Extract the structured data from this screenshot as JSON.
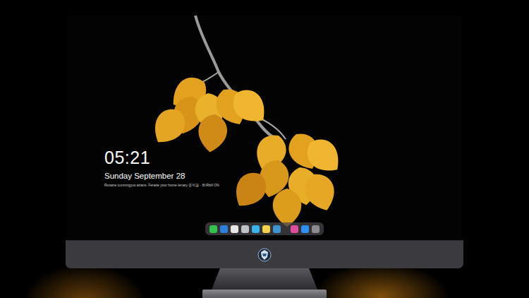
{
  "lock_screen": {
    "clock": "05:21",
    "date": "Sunday September  28",
    "notice": "Rosane cunnnrgyus arians. Feraite your home lenary 웅력결 · 8i:Rbill ON"
  },
  "dock": {
    "items": [
      {
        "color": "#34c24c"
      },
      {
        "color": "#2f7fe0"
      },
      {
        "color": "#e6e6e6"
      },
      {
        "color": "#bfc3c8"
      },
      {
        "color": "#3ab2ea"
      },
      {
        "color": "#f4d24c"
      },
      {
        "color": "#3f93cf"
      },
      {
        "color": "#e24c9c"
      },
      {
        "color": "#2f8ff2"
      },
      {
        "color": "#8c8c90"
      }
    ]
  }
}
